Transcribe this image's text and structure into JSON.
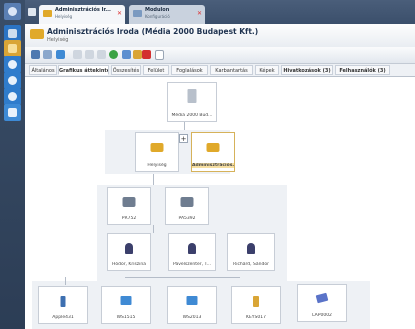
{
  "tabs": [
    {
      "title": "Adminisztrációs Ir...",
      "subtitle": "Helyiség"
    },
    {
      "title": "Modulon",
      "subtitle": "Konfiguráció"
    }
  ],
  "header": {
    "title": "Adminisztrációs Iroda (Média 2000 Budapest Kft.)",
    "subtitle": "Helyiség"
  },
  "subtabs": [
    "Általános",
    "Grafikus áttekintés",
    "Összesítés",
    "Felület",
    "Foglalások",
    "Karbantartás",
    "Képek",
    "Hivatkozások (3)",
    "Felhasználók (3)"
  ],
  "nodes": {
    "root": "Média 2000 Bud...",
    "left": "Helyiség",
    "right": "Adminisztrációs...",
    "dev1": "PR752",
    "dev2": "PA5392",
    "p1": "Hódor, Kriszina",
    "p2": "Pavelszenter, T...",
    "p3": "Richárd, Sándor",
    "b1": "Apple431",
    "b2": "WS1515",
    "b3": "WS2013",
    "b4": "KEYS017",
    "b5": "LAP0002"
  },
  "expander": "+",
  "colors": {
    "accent": "#e0a92a",
    "sidebar": "#2f425c"
  }
}
